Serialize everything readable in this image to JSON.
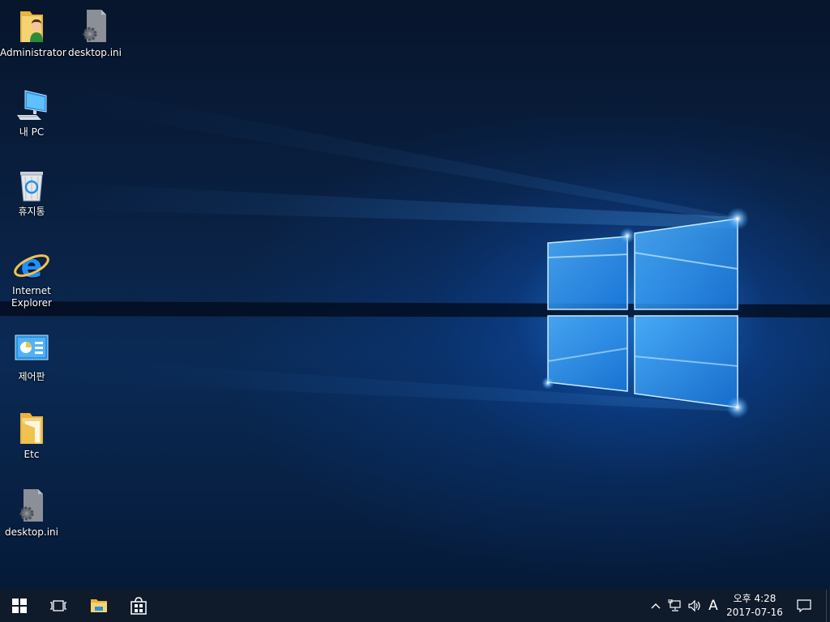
{
  "desktop": {
    "icons": [
      {
        "label": "Administrator",
        "icon": "user-folder-icon"
      },
      {
        "label": "desktop.ini",
        "icon": "settings-file-icon"
      },
      {
        "label": "내 PC",
        "icon": "computer-icon"
      },
      {
        "label": "휴지통",
        "icon": "recycle-bin-icon"
      },
      {
        "label": "Internet Explorer",
        "icon": "internet-explorer-icon"
      },
      {
        "label": "제어판",
        "icon": "control-panel-icon"
      },
      {
        "label": "Etc",
        "icon": "folder-icon"
      },
      {
        "label": "desktop.ini",
        "icon": "settings-file-icon"
      }
    ]
  },
  "taskbar": {
    "start": {
      "icon": "windows-start-icon"
    },
    "task_view": {
      "icon": "task-view-icon"
    },
    "pinned": [
      {
        "icon": "file-explorer-icon"
      },
      {
        "icon": "store-icon"
      }
    ],
    "tray": {
      "chevron": {
        "icon": "chevron-up-icon"
      },
      "network": {
        "icon": "network-icon"
      },
      "volume": {
        "icon": "volume-icon"
      },
      "ime_label": "A",
      "time": "오후 4:28",
      "date": "2017-07-16",
      "notifications": {
        "icon": "action-center-icon"
      }
    }
  },
  "colors": {
    "taskbar_bg": "#0f1a2b",
    "wallpaper_glow": "#2c9bff",
    "folder_yellow": "#f2c14f"
  }
}
